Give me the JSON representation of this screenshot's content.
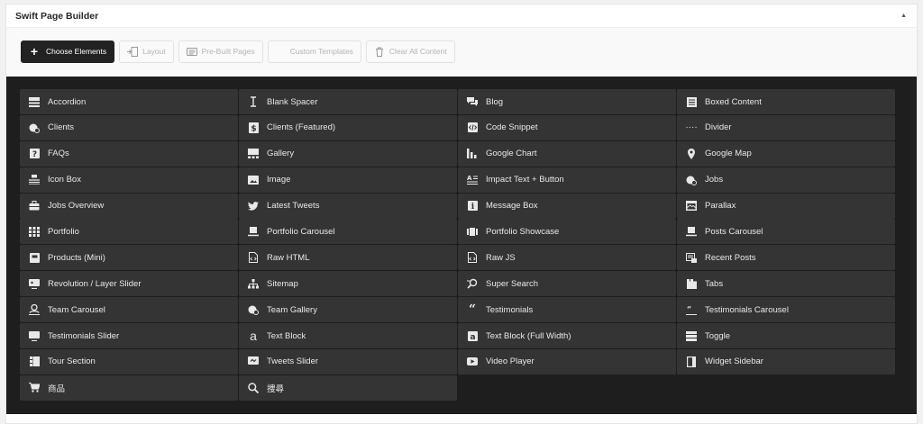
{
  "panel": {
    "title": "Swift Page Builder",
    "collapse_icon": "triangle-up-icon"
  },
  "toolbar": {
    "buttons": [
      {
        "label": "Choose Elements",
        "icon": "plus-icon",
        "active": true
      },
      {
        "label": "Layout",
        "icon": "layout-icon",
        "active": false
      },
      {
        "label": "Pre-Built Pages",
        "icon": "pages-icon",
        "active": false
      },
      {
        "label": "Custom Templates",
        "icon": "",
        "active": false
      },
      {
        "label": "Clear All Content",
        "icon": "trash-icon",
        "active": false
      }
    ]
  },
  "elements": [
    {
      "label": "Accordion",
      "icon": "accordion-icon"
    },
    {
      "label": "Blank Spacer",
      "icon": "text-cursor-icon"
    },
    {
      "label": "Blog",
      "icon": "chat-bubbles-icon"
    },
    {
      "label": "Boxed Content",
      "icon": "document-icon"
    },
    {
      "label": "Clients",
      "icon": "clients-icon"
    },
    {
      "label": "Clients (Featured)",
      "icon": "clients-featured-icon"
    },
    {
      "label": "Code Snippet",
      "icon": "code-icon"
    },
    {
      "label": "Divider",
      "icon": "dots-icon"
    },
    {
      "label": "FAQs",
      "icon": "question-icon"
    },
    {
      "label": "Gallery",
      "icon": "gallery-icon"
    },
    {
      "label": "Google Chart",
      "icon": "bar-chart-icon"
    },
    {
      "label": "Google Map",
      "icon": "map-marker-icon"
    },
    {
      "label": "Icon Box",
      "icon": "icon-box-icon"
    },
    {
      "label": "Image",
      "icon": "image-icon"
    },
    {
      "label": "Impact Text + Button",
      "icon": "impact-text-icon"
    },
    {
      "label": "Jobs",
      "icon": "jobs-icon"
    },
    {
      "label": "Jobs Overview",
      "icon": "briefcase-icon"
    },
    {
      "label": "Latest Tweets",
      "icon": "twitter-icon"
    },
    {
      "label": "Message Box",
      "icon": "info-icon"
    },
    {
      "label": "Parallax",
      "icon": "parallax-icon"
    },
    {
      "label": "Portfolio",
      "icon": "grid-icon"
    },
    {
      "label": "Portfolio Carousel",
      "icon": "portfolio-carousel-icon"
    },
    {
      "label": "Portfolio Showcase",
      "icon": "showcase-icon"
    },
    {
      "label": "Posts Carousel",
      "icon": "posts-carousel-icon"
    },
    {
      "label": "Products (Mini)",
      "icon": "product-icon"
    },
    {
      "label": "Raw HTML",
      "icon": "html-file-icon"
    },
    {
      "label": "Raw JS",
      "icon": "js-file-icon"
    },
    {
      "label": "Recent Posts",
      "icon": "recent-posts-icon"
    },
    {
      "label": "Revolution / Layer Slider",
      "icon": "slider-icon"
    },
    {
      "label": "Sitemap",
      "icon": "sitemap-icon"
    },
    {
      "label": "Super Search",
      "icon": "super-search-icon"
    },
    {
      "label": "Tabs",
      "icon": "tabs-icon"
    },
    {
      "label": "Team Carousel",
      "icon": "team-carousel-icon"
    },
    {
      "label": "Team Gallery",
      "icon": "team-gallery-icon"
    },
    {
      "label": "Testimonials",
      "icon": "quote-icon"
    },
    {
      "label": "Testimonials Carousel",
      "icon": "testimonials-carousel-icon"
    },
    {
      "label": "Testimonials Slider",
      "icon": "testimonials-slider-icon"
    },
    {
      "label": "Text Block",
      "icon": "text-a-icon"
    },
    {
      "label": "Text Block (Full Width)",
      "icon": "text-a-boxed-icon"
    },
    {
      "label": "Toggle",
      "icon": "toggle-icon"
    },
    {
      "label": "Tour Section",
      "icon": "tour-icon"
    },
    {
      "label": "Tweets Slider",
      "icon": "tweets-slider-icon"
    },
    {
      "label": "Video Player",
      "icon": "play-icon"
    },
    {
      "label": "Widget Sidebar",
      "icon": "sidebar-icon"
    },
    {
      "label": "商品",
      "icon": "cart-icon"
    },
    {
      "label": "捜尋",
      "icon": "search-icon"
    }
  ]
}
